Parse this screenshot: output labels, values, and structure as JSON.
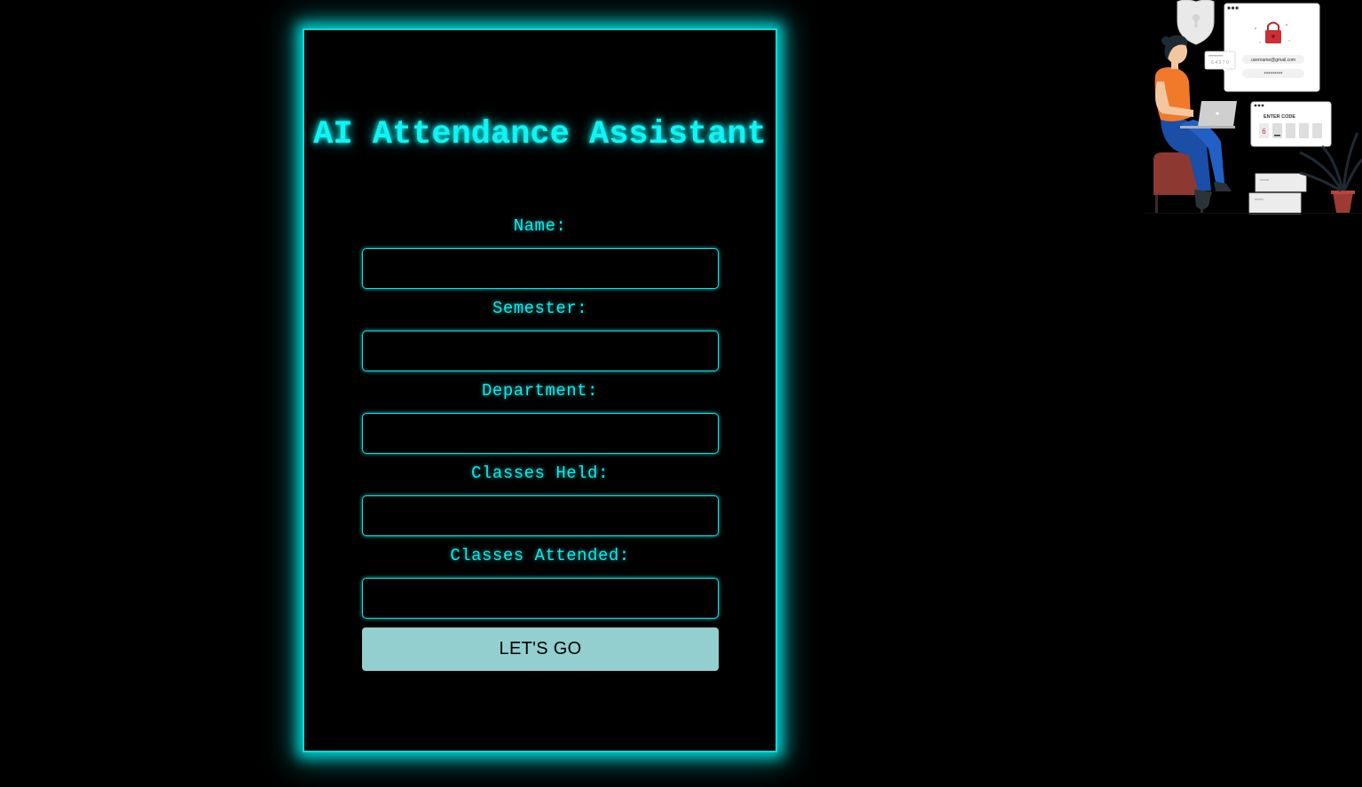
{
  "app": {
    "title": "AI Attendance Assistant",
    "accent_color": "#12f3f3",
    "background_color": "#000000"
  },
  "form": {
    "fields": [
      {
        "label": "Name:",
        "value": ""
      },
      {
        "label": "Semester:",
        "value": ""
      },
      {
        "label": "Department:",
        "value": ""
      },
      {
        "label": "Classes Held:",
        "value": ""
      },
      {
        "label": "Classes Attended:",
        "value": ""
      }
    ],
    "submit_label": "LET'S GO",
    "submit_color": "#93cfcf"
  },
  "illustration": {
    "popup_text": {
      "email": "username@gmail.com",
      "password": "*********",
      "enter_code": "ENTER CODE",
      "code_first_digit": "6",
      "otp_digits": "6 4 3 7 0"
    },
    "icons": [
      "shield-icon",
      "lock-icon",
      "laptop-icon",
      "plant-icon"
    ]
  }
}
